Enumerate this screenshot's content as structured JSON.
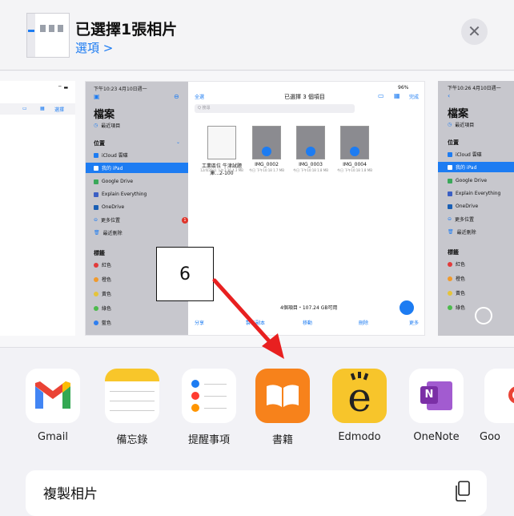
{
  "header": {
    "title": "已選擇1張相片",
    "options_link": "選項 >",
    "close_glyph": "✕"
  },
  "preview": {
    "main": {
      "time": "下午10:23  4月10日週一",
      "battery": "96%",
      "sidebar_title": "檔案",
      "recent": "最近項目",
      "locations_header": "位置",
      "locations": [
        "iCloud 雲碟",
        "我的 iPad",
        "Google Drive",
        "Explain Everything",
        "OneDrive",
        "更多位置",
        "最近刪除"
      ],
      "more_badge": "1",
      "tags_header": "標籤",
      "tags": [
        "紅色",
        "橙色",
        "黃色",
        "綠色",
        "藍色"
      ],
      "tag_colors": [
        "#e23b3b",
        "#f09a2c",
        "#e5c43a",
        "#4cba4c",
        "#2f7ff0"
      ],
      "select_all": "全選",
      "toolbar_title": "已選擇 3 個項目",
      "done": "完成",
      "search_placeholder": "Q 搜尋",
      "files": [
        {
          "name": "工業區位 牛津試題庫...2-100",
          "meta": "12/4/2021 下午7:36 4.3 MB"
        },
        {
          "name": "IMG_0002",
          "meta": "今日 下午10:18 1.7 MB"
        },
        {
          "name": "IMG_0003",
          "meta": "今日 下午10:18 1.8 MB"
        },
        {
          "name": "IMG_0004",
          "meta": "今日 下午10:18 1.8 MB"
        }
      ],
      "status": "4個項目・107.24 GB可用",
      "bottom_actions": [
        "分享",
        "製作副本",
        "移動",
        "刪除",
        "更多"
      ]
    },
    "left_partial": {
      "edit": "選擇"
    },
    "right_partial": {
      "time": "下午10:26  4月10日週一",
      "sidebar_title": "檔案",
      "recent": "最近項目",
      "locations_header": "位置",
      "locations": [
        "iCloud 雲碟",
        "我的 iPad",
        "Google Drive",
        "Explain Everything",
        "OneDrive",
        "更多位置",
        "最近刪除"
      ],
      "tags_header": "標籤",
      "tags": [
        "紅色",
        "橙色",
        "黃色",
        "綠色"
      ]
    }
  },
  "annotation": {
    "callout_number": "6"
  },
  "apps": [
    {
      "label": "Gmail",
      "icon": "gmail-icon"
    },
    {
      "label": "備忘錄",
      "icon": "notes-icon"
    },
    {
      "label": "提醒事項",
      "icon": "reminders-icon"
    },
    {
      "label": "書籍",
      "icon": "books-icon"
    },
    {
      "label": "Edmodo",
      "icon": "edmodo-icon"
    },
    {
      "label": "OneNote",
      "icon": "onenote-icon"
    },
    {
      "label": "Goo",
      "icon": "google-icon"
    }
  ],
  "actions": {
    "copy_photo": "複製相片",
    "copy_icon": "copy-icon"
  },
  "colors": {
    "accent": "#1d7cf2",
    "annotation_arrow": "#e82020",
    "books_orange": "#f7821b",
    "edmodo_yellow": "#f7c52b",
    "onenote_purple": "#7b2fa6"
  }
}
